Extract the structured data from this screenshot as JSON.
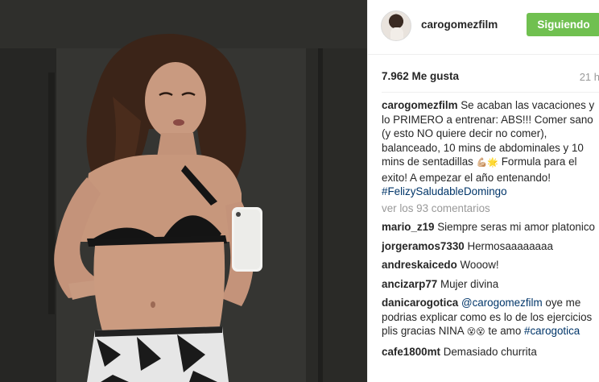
{
  "post": {
    "image_alt": "Mirror selfie in black bikini top",
    "phone_icon": "apple-logo-icon"
  },
  "header": {
    "username": "carogomezfilm",
    "follow_label": "Siguiendo",
    "follow_color": "#70c050"
  },
  "stats": {
    "likes": "7.962 Me gusta",
    "time": "21 h"
  },
  "caption": {
    "username": "carogomezfilm",
    "text": " Se acaban las vacaciones y lo PRIMERO a entrenar: ABS!!! Comer sano (y esto NO quiere decir no comer), balanceado, 10 mins de abdominales y 10 mins de sentadillas ",
    "emoji": "💪🏼🌟",
    "text2": " Formula para el exito! A empezar el año entenando! ",
    "hashtag": "#FelizySaludableDomingo"
  },
  "view_all": "ver los 93 comentarios",
  "comments": [
    {
      "user": "mario_z19",
      "text": " Siempre seras mi amor platonico"
    },
    {
      "user": "jorgeramos7330",
      "text": " Hermosaaaaaaaa"
    },
    {
      "user": "andreskaicedo",
      "text": " Wooow!"
    },
    {
      "user": "ancizarp77",
      "text": " Mujer divina"
    },
    {
      "user": "danicarogotica",
      "mention": "@carogomezfilm",
      "text": " oye me podrias explicar como es lo de los ejercicios plis gracias NINA ",
      "emoji": "😵😵",
      "text2": " te amo ",
      "hashtag": "#carogotica"
    },
    {
      "user": "cafe1800mt",
      "text": " Demasiado churrita"
    }
  ],
  "colors": {
    "link": "#003569",
    "muted": "#999999",
    "divider": "#efefef"
  }
}
